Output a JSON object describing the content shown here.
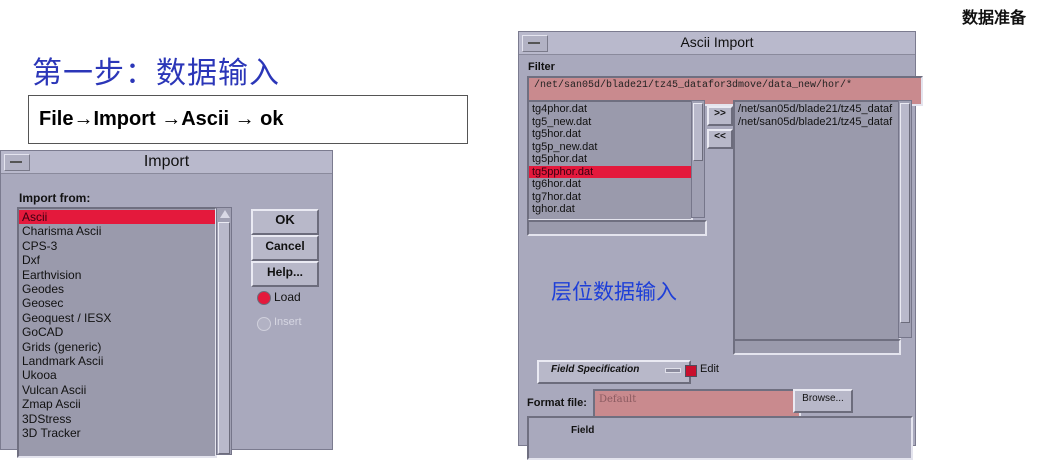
{
  "slide": {
    "corner_title": "数据准备",
    "step_title": "第一步：数据输入",
    "menu_path": "File→Import →Ascii → ok",
    "annotation": "层位数据输入"
  },
  "import_dialog": {
    "title": "Import",
    "import_from_label": "Import from:",
    "items": [
      "Ascii",
      "Charisma Ascii",
      "CPS-3",
      "Dxf",
      "Earthvision",
      "Geodes",
      "Geosec",
      "Geoquest / IESX",
      "GoCAD",
      "Grids (generic)",
      "Landmark Ascii",
      "Ukooa",
      "Vulcan Ascii",
      "Zmap Ascii",
      "3DStress",
      "3D Tracker"
    ],
    "selected_index": 0,
    "ok_label": "OK",
    "cancel_label": "Cancel",
    "help_label": "Help...",
    "load_label": "Load",
    "insert_label": "Insert"
  },
  "ascii_dialog": {
    "title": "Ascii Import",
    "filter_label": "Filter",
    "filter_value": "/net/san05d/blade21/tz45_datafor3dmove/data_new/hor/*",
    "files": [
      "tg4phor.dat",
      "tg5_new.dat",
      "tg5hor.dat",
      "tg5p_new.dat",
      "tg5phor.dat",
      "tg5pphor.dat",
      "tg6hor.dat",
      "tg7hor.dat",
      "tghor.dat"
    ],
    "selected_file_index": 5,
    "add_label": ">>",
    "remove_label": "<<",
    "selected_paths": [
      "/net/san05d/blade21/tz45_dataf",
      "/net/san05d/blade21/tz45_dataf"
    ],
    "field_spec_label": "Field Specification",
    "edit_label": "Edit",
    "format_file_label": "Format file:",
    "format_file_value": "Default",
    "browse_label": "Browse...",
    "field_label": "Field"
  }
}
